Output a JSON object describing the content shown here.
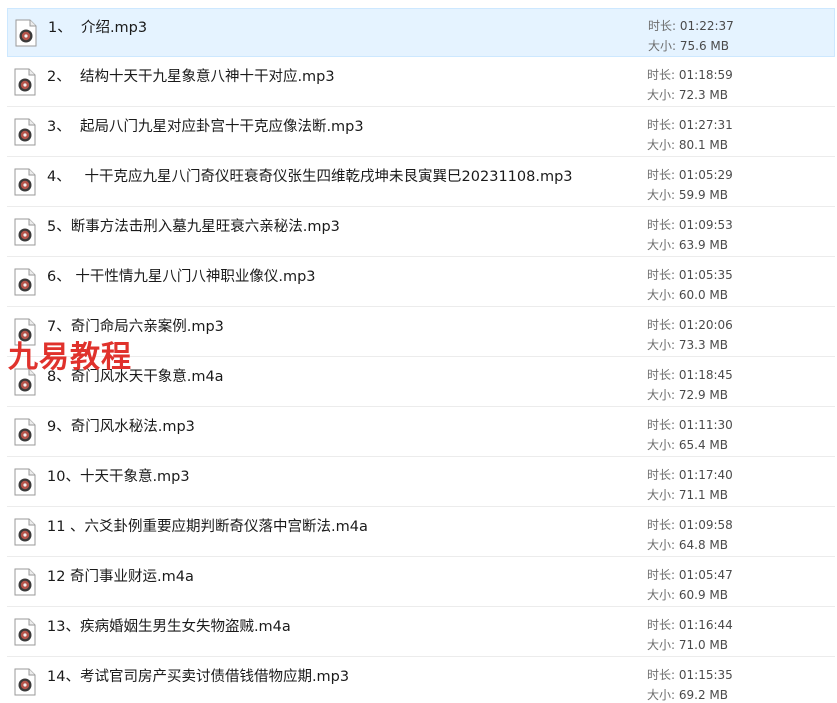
{
  "labels": {
    "duration": "时长:",
    "size": "大小:"
  },
  "icon": "audio-file-icon",
  "files": [
    {
      "name": "1、  介绍.mp3",
      "duration": "01:22:37",
      "size": "75.6 MB",
      "selected": true
    },
    {
      "name": "2、  结构十天干九星象意八神十干对应.mp3",
      "duration": "01:18:59",
      "size": "72.3 MB"
    },
    {
      "name": "3、  起局八门九星对应卦宫十干克应像法断.mp3",
      "duration": "01:27:31",
      "size": "80.1 MB"
    },
    {
      "name": "4、   十干克应九星八门奇仪旺衰奇仪张生四维乾戌坤未艮寅巽巳20231108.mp3",
      "duration": "01:05:29",
      "size": "59.9 MB"
    },
    {
      "name": "5、断事方法击刑入墓九星旺衰六亲秘法.mp3",
      "duration": "01:09:53",
      "size": "63.9 MB"
    },
    {
      "name": "6、 十干性情九星八门八神职业像仪.mp3",
      "duration": "01:05:35",
      "size": "60.0 MB"
    },
    {
      "name": "7、奇门命局六亲案例.mp3",
      "duration": "01:20:06",
      "size": "73.3 MB"
    },
    {
      "name": "8、奇门风水天干象意.m4a",
      "duration": "01:18:45",
      "size": "72.9 MB"
    },
    {
      "name": "9、奇门风水秘法.mp3",
      "duration": "01:11:30",
      "size": "65.4 MB"
    },
    {
      "name": "10、十天干象意.mp3",
      "duration": "01:17:40",
      "size": "71.1 MB"
    },
    {
      "name": "11 、六爻卦例重要应期判断奇仪落中宫断法.m4a",
      "duration": "01:09:58",
      "size": "64.8 MB"
    },
    {
      "name": "12 奇门事业财运.m4a",
      "duration": "01:05:47",
      "size": "60.9 MB"
    },
    {
      "name": "13、疾病婚姻生男生女失物盗贼.m4a",
      "duration": "01:16:44",
      "size": "71.0 MB"
    },
    {
      "name": "14、考试官司房产买卖讨债借钱借物应期.mp3",
      "duration": "01:15:35",
      "size": "69.2 MB"
    }
  ],
  "watermark": "九易教程"
}
